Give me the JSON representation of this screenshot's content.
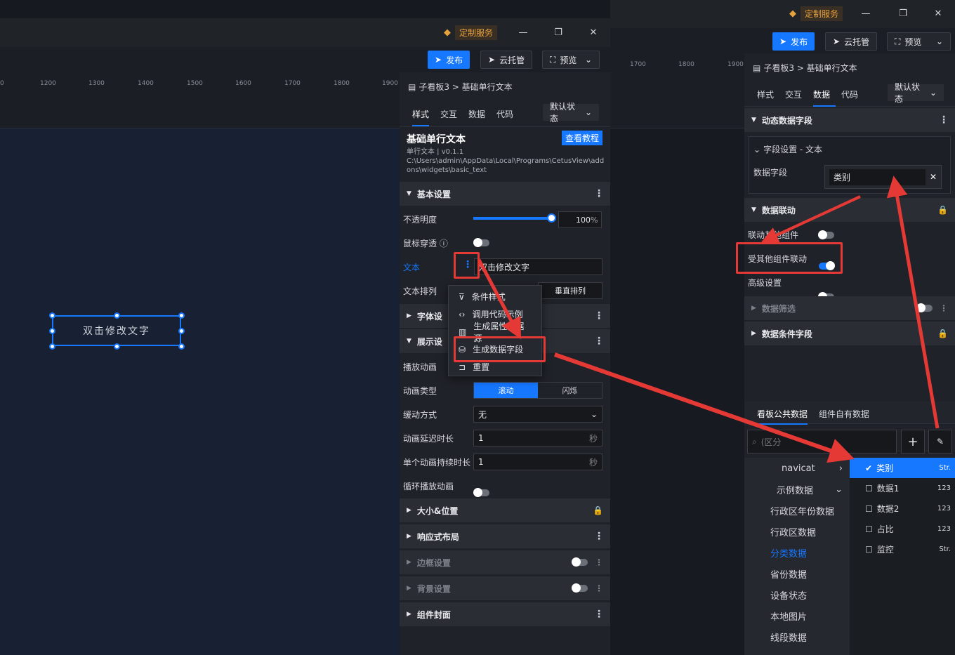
{
  "app": {
    "vip_label": "定制服务",
    "publish": "发布",
    "cloud": "云托管",
    "preview": "预览"
  },
  "ruler_left": [
    "0",
    "1200",
    "1300",
    "1400",
    "1500",
    "1600",
    "1700",
    "1800",
    "1900"
  ],
  "ruler_right": [
    "1700",
    "1800",
    "1900"
  ],
  "canvas": {
    "widget_text": "双击修改文字"
  },
  "panel": {
    "breadcrumb": "子看板3 > 基础单行文本",
    "tabs": [
      "样式",
      "交互",
      "数据",
      "代码"
    ],
    "state": "默认状态",
    "widget_title": "基础单行文本",
    "tutorial": "查看教程",
    "widget_sub": "单行文本 | v0.1.1",
    "widget_path": "C:\\Users\\admin\\AppData\\Local\\Programs\\CetusView\\addons\\widgets\\basic_text",
    "sec_basic": "基本设置",
    "opacity_label": "不透明度",
    "opacity_value": "100",
    "opacity_unit": "%",
    "opacity": 1.0,
    "mouse_label": "鼠标穿透",
    "text_label": "文本",
    "text_value": "双击修改文字",
    "arrange_label": "文本排列",
    "arrange_opt": "垂直排列",
    "sec_font": "字体设",
    "sec_display": "展示设",
    "anim_play": "播放动画",
    "anim_type": "动画类型",
    "anim_opts": [
      "滚动",
      "闪烁"
    ],
    "ease_label": "缓动方式",
    "ease_value": "无",
    "delay_label": "动画延迟时长",
    "delay_value": "1",
    "delay_unit": "秒",
    "duration_label": "单个动画持续时长",
    "duration_value": "1",
    "duration_unit": "秒",
    "loop_label": "循环播放动画",
    "sec_size": "大小&位置",
    "sec_resp": "响应式布局",
    "sec_border": "边框设置",
    "sec_bg": "背景设置",
    "sec_cover": "组件封面"
  },
  "menu": [
    "条件样式",
    "调用代码示例",
    "生成属性数据源",
    "生成数据字段",
    "重置"
  ],
  "right": {
    "breadcrumb": "子看板3 > 基础单行文本",
    "tabs": [
      "样式",
      "交互",
      "数据",
      "代码"
    ],
    "state": "默认状态",
    "sec_dynamic": "动态数据字段",
    "field_setting": "字段设置 - 文本",
    "data_field_label": "数据字段",
    "data_field_value": "类别",
    "sec_link": "数据联动",
    "link_other": "联动其他组件",
    "linked_by": "受其他组件联动",
    "advanced": "高级设置",
    "sec_filter": "数据筛选",
    "sec_cond": "数据条件字段",
    "data_tabs": [
      "看板公共数据",
      "组件自有数据"
    ],
    "search_placeholder": "(区分",
    "sources": [
      "navicat",
      "示例数据",
      "行政区年份数据",
      "行政区数据",
      "分类数据",
      "省份数据",
      "设备状态",
      "本地图片",
      "线段数据"
    ],
    "fields": [
      {
        "name": "类别",
        "type": "Str."
      },
      {
        "name": "数据1",
        "type": "123"
      },
      {
        "name": "数据2",
        "type": "123"
      },
      {
        "name": "占比",
        "type": "123"
      },
      {
        "name": "监控",
        "type": "Str."
      }
    ]
  }
}
